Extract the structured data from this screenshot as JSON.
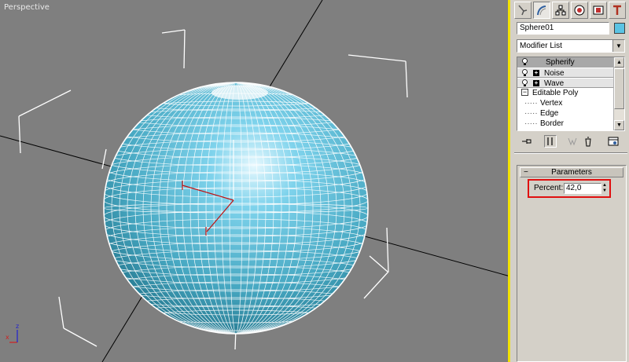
{
  "viewport": {
    "label": "Perspective",
    "gizmo_axes": [
      "x",
      "z"
    ]
  },
  "panel": {
    "tabs": [
      {
        "icon": "create-tab-icon"
      },
      {
        "icon": "modify-tab-icon"
      },
      {
        "icon": "hierarchy-tab-icon"
      },
      {
        "icon": "motion-tab-icon"
      },
      {
        "icon": "display-tab-icon"
      },
      {
        "icon": "utilities-tab-icon"
      }
    ],
    "object_name": "Sphere01",
    "object_color": "#5bc3e3",
    "modifier_list": "Modifier List",
    "stack": [
      {
        "label": "Spherify"
      },
      {
        "label": "Noise",
        "expand": "+"
      },
      {
        "label": "Wave",
        "expand": "+"
      },
      {
        "label": "Editable Poly",
        "expand": "−"
      },
      {
        "label": "Vertex",
        "prefix": "·····"
      },
      {
        "label": "Edge",
        "prefix": "·····"
      },
      {
        "label": "Border",
        "prefix": "·····"
      }
    ],
    "rollout": {
      "title": "Parameters",
      "collapse": "−",
      "percent_label": "Percent:",
      "percent_value": "42,0"
    }
  }
}
